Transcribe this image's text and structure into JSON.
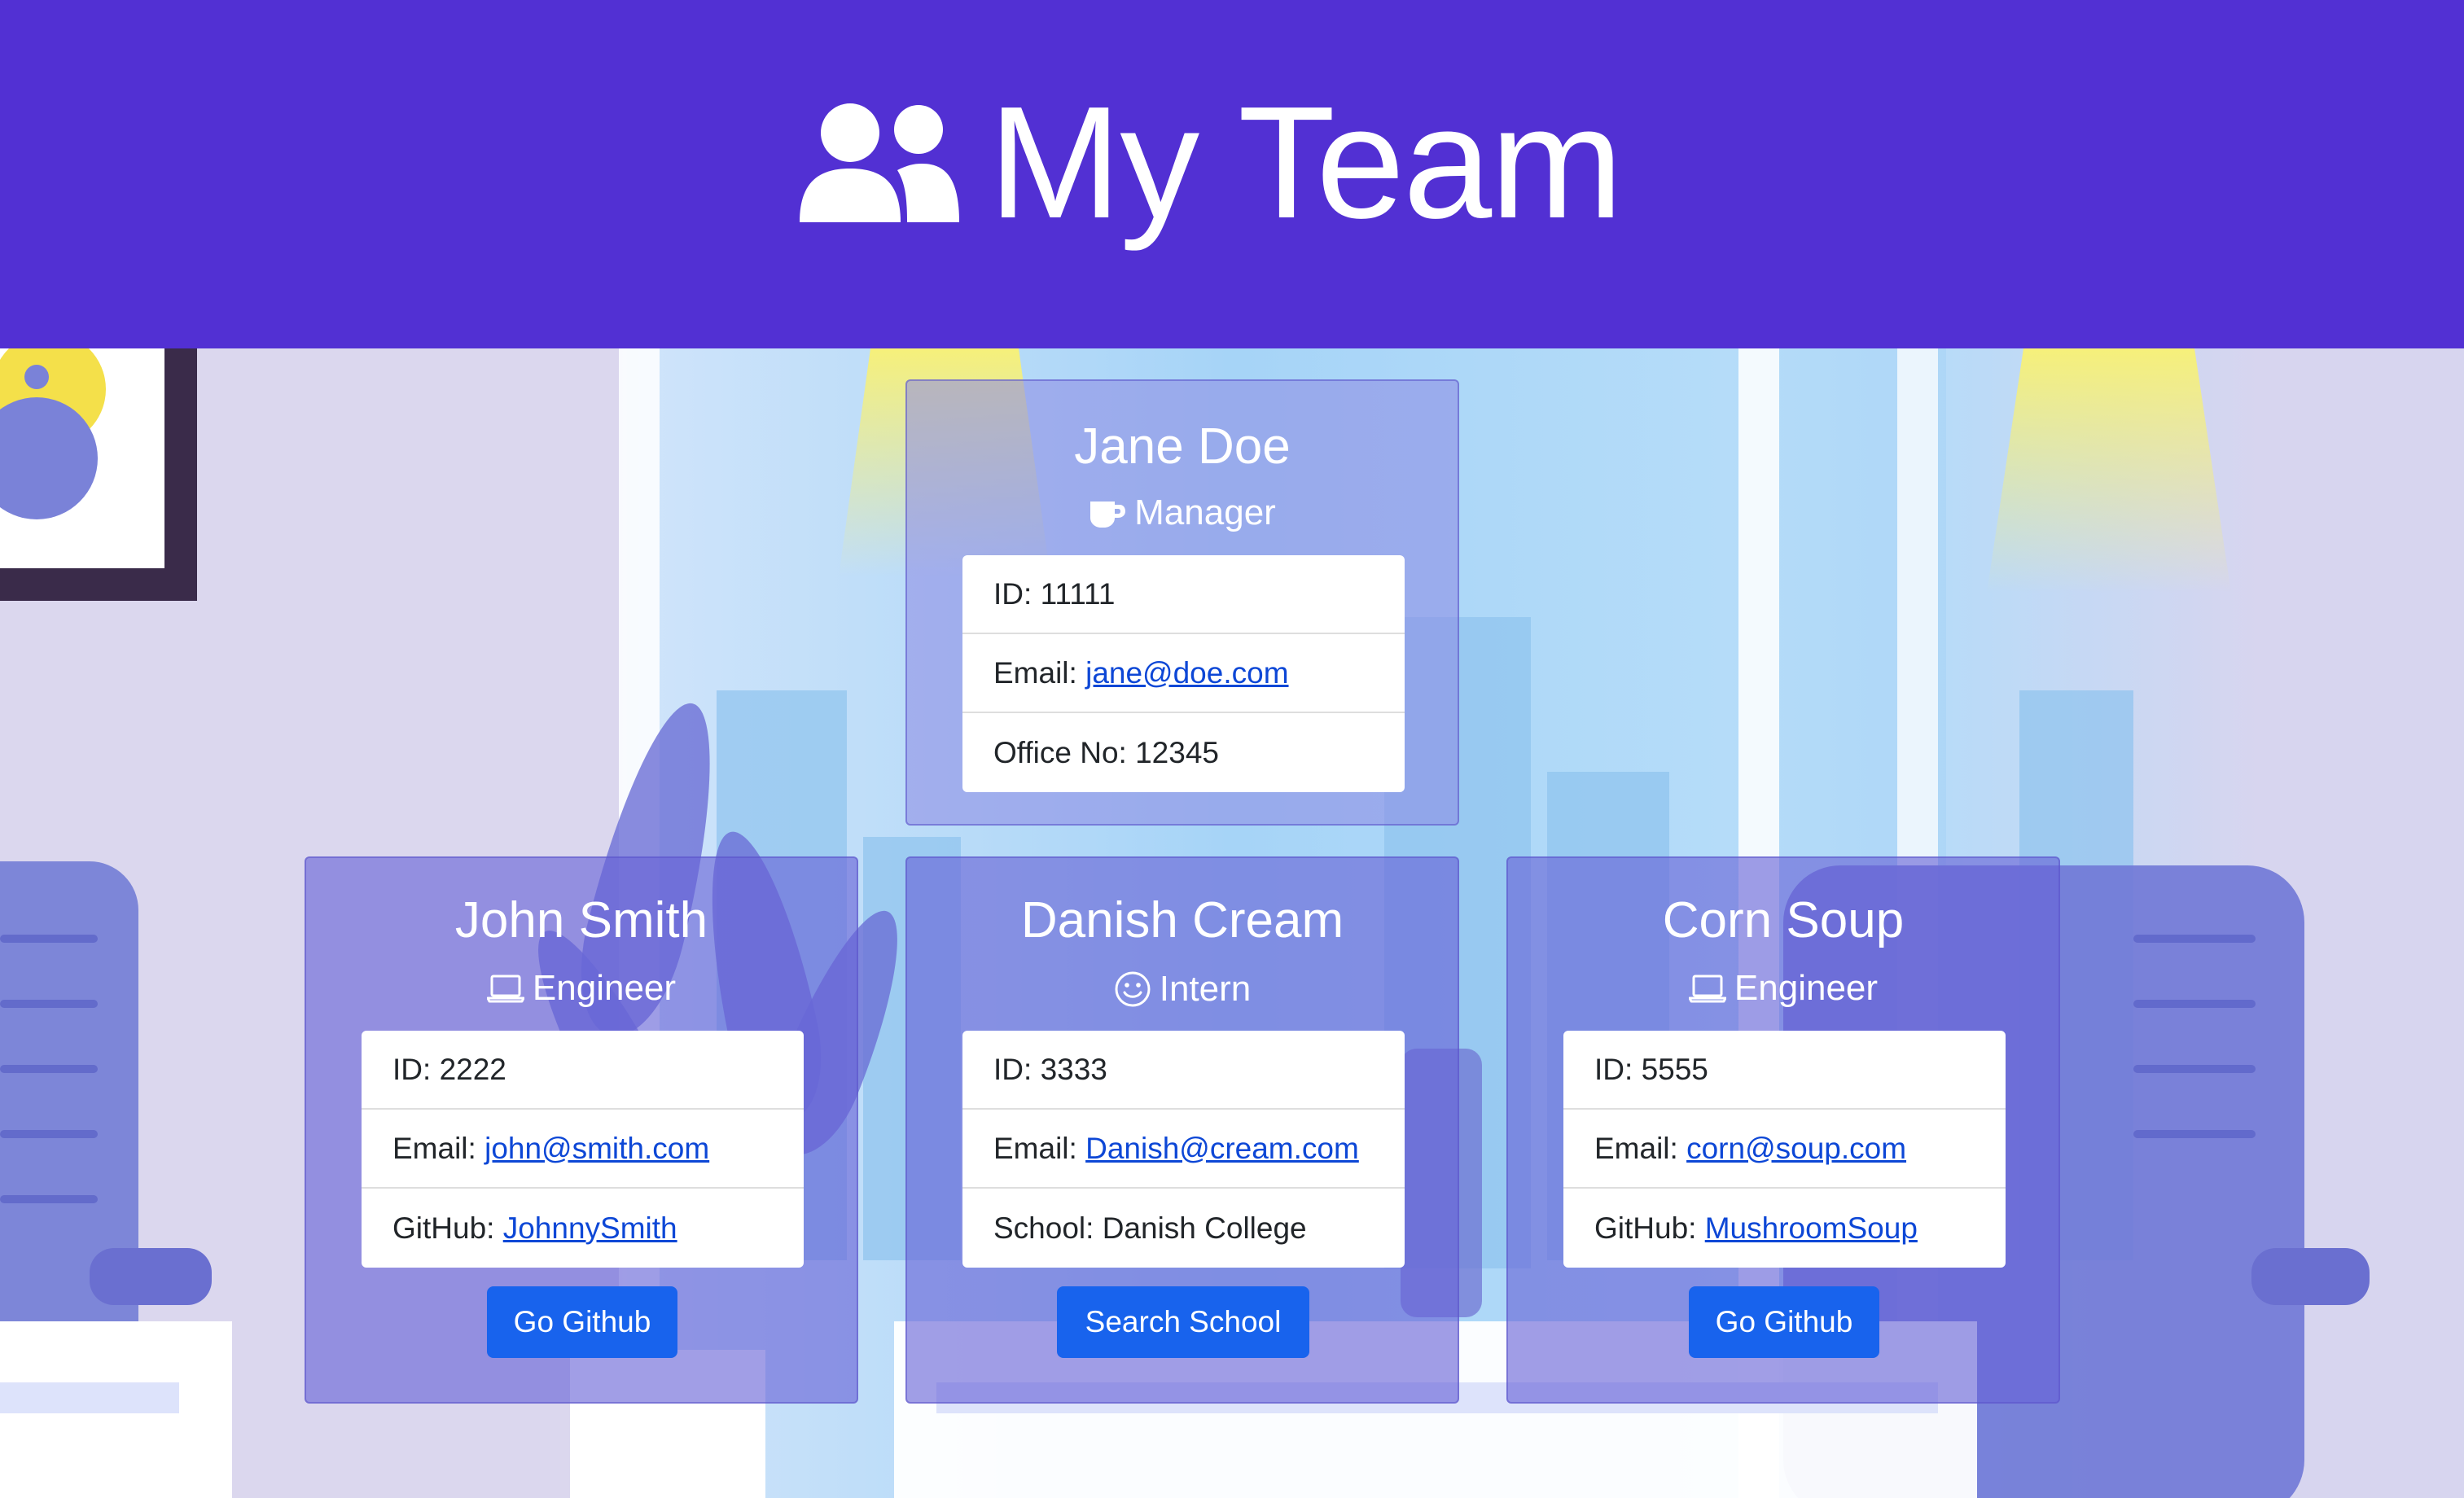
{
  "header": {
    "title": "My Team",
    "icon": "users-icon",
    "background_color": "#5230d3"
  },
  "manager": {
    "name": "Jane Doe",
    "role": "Manager",
    "role_icon": "mug-icon",
    "id_label": "ID:",
    "id": "11111",
    "email_label": "Email:",
    "email": "jane@doe.com",
    "office_label": "Office No:",
    "office": "12345"
  },
  "engineer1": {
    "name": "John Smith",
    "role": "Engineer",
    "role_icon": "laptop-icon",
    "id_label": "ID:",
    "id": "2222",
    "email_label": "Email:",
    "email": "john@smith.com",
    "github_label": "GitHub:",
    "github": "JohnnySmith",
    "button_label": "Go Github"
  },
  "intern": {
    "name": "Danish Cream",
    "role": "Intern",
    "role_icon": "smile-icon",
    "id_label": "ID:",
    "id": "3333",
    "email_label": "Email:",
    "email": "Danish@cream.com",
    "school_label": "School:",
    "school": "Danish College",
    "button_label": "Search School"
  },
  "engineer2": {
    "name": "Corn Soup",
    "role": "Engineer",
    "role_icon": "laptop-icon",
    "id_label": "ID:",
    "id": "5555",
    "email_label": "Email:",
    "email": "corn@soup.com",
    "github_label": "GitHub:",
    "github": "MushroomSoup",
    "button_label": "Go Github"
  },
  "colors": {
    "button": "#1863ed",
    "link": "#0d47d6",
    "card": "#6762d6"
  }
}
